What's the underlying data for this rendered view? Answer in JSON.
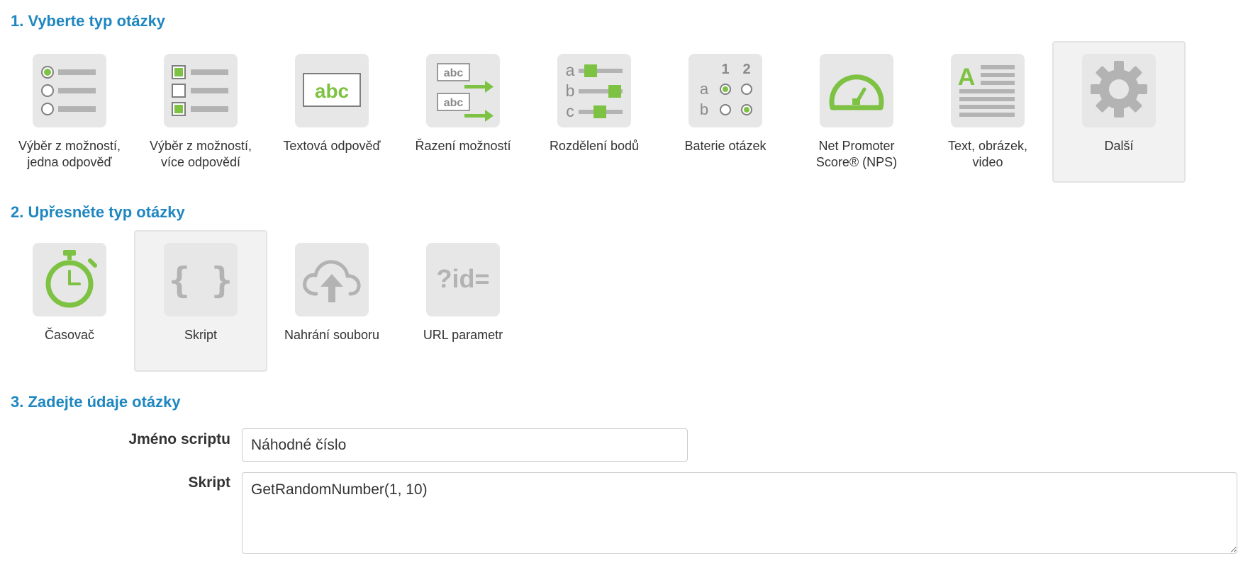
{
  "step1": {
    "title": "1. Vyberte typ otázky",
    "tiles": [
      {
        "label": "Výběr z možností,\njedna odpověď",
        "icon": "single-choice-icon"
      },
      {
        "label": "Výběr z možností,\nvíce odpovědí",
        "icon": "multiple-choice-icon"
      },
      {
        "label": "Textová odpověď",
        "icon": "text-answer-icon",
        "icon_text": "abc"
      },
      {
        "label": "Řazení možností",
        "icon": "ordering-icon",
        "icon_text": "abc"
      },
      {
        "label": "Rozdělení bodů",
        "icon": "points-distribution-icon",
        "icon_letters": [
          "a",
          "b",
          "c"
        ]
      },
      {
        "label": "Baterie otázek",
        "icon": "question-battery-icon",
        "icon_cols": [
          "1",
          "2"
        ],
        "icon_rows": [
          "a",
          "b"
        ]
      },
      {
        "label": "Net Promoter\nScore® (NPS)",
        "icon": "gauge-icon"
      },
      {
        "label": "Text, obrázek,\nvideo",
        "icon": "text-image-icon",
        "icon_text": "A"
      },
      {
        "label": "Další",
        "icon": "gear-icon",
        "selected": true
      }
    ]
  },
  "step2": {
    "title": "2. Upřesněte typ otázky",
    "tiles": [
      {
        "label": "Časovač",
        "icon": "stopwatch-icon"
      },
      {
        "label": "Skript",
        "icon": "braces-icon",
        "icon_text": "{ }",
        "selected": true
      },
      {
        "label": "Nahrání souboru",
        "icon": "cloud-upload-icon"
      },
      {
        "label": "URL parametr",
        "icon": "url-param-icon",
        "icon_text": "?id="
      }
    ]
  },
  "step3": {
    "title": "3. Zadejte údaje otázky",
    "script_name_label": "Jméno scriptu",
    "script_name_value": "Náhodné číslo",
    "script_label": "Skript",
    "script_value": "GetRandomNumber(1, 10)"
  },
  "colors": {
    "heading": "#1f87c0",
    "accent_green": "#7dc242",
    "icon_gray": "#b3b3b3",
    "icon_bg": "#e7e7e7",
    "selected_bg": "#f2f2f2"
  }
}
